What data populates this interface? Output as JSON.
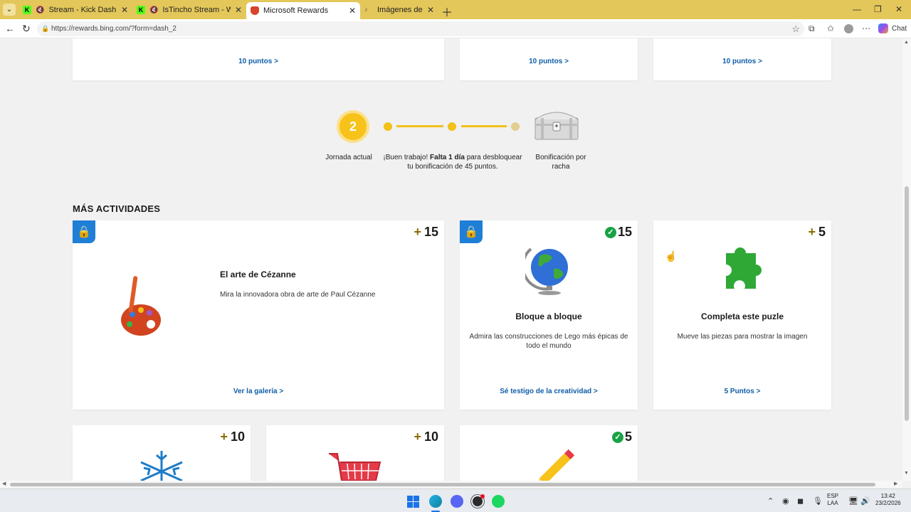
{
  "browser": {
    "tabs": [
      {
        "title": "Stream - Kick Dashboard",
        "favicon_color": "#53fc18"
      },
      {
        "title": "IsTincho Stream - Watch Live",
        "favicon_color": "#53fc18"
      },
      {
        "title": "Microsoft Rewards",
        "favicon_color": "#d8442a"
      },
      {
        "title": "Imágenes de obras",
        "favicon_color": "#555555"
      }
    ],
    "url": "https://rewards.bing.com/?form=dash_2",
    "chat_label": "Chat"
  },
  "top_cards": [
    {
      "link": "10 puntos >"
    },
    {
      "link": "10 puntos >"
    },
    {
      "link": "10 puntos >"
    }
  ],
  "streak": {
    "current_day": "2",
    "current_label": "Jornada actual",
    "message_prefix": "¡Buen trabajo! ",
    "message_bold": "Falta 1 día",
    "message_suffix": " para desbloquear tu bonificación de 45 puntos.",
    "bonus_label": "Bonificación por racha"
  },
  "section_title": "MÁS ACTIVIDADES",
  "activities": [
    {
      "points_prefix": "+",
      "points": "15",
      "title": "El arte de Cézanne",
      "description": "Mira la innovadora obra de arte de Paul Cézanne",
      "link": "Ver la galería >",
      "locked": true,
      "completed": false
    },
    {
      "points_prefix": "",
      "points": "15",
      "title": "Bloque a bloque",
      "description": "Admira las construcciones de Lego más épicas de todo el mundo",
      "link": "Sé testigo de la creatividad >",
      "locked": true,
      "completed": true
    },
    {
      "points_prefix": "+",
      "points": "5",
      "title": "Completa este puzle",
      "description": "Mueve las piezas para mostrar la imagen",
      "link": "5 Puntos >",
      "locked": false,
      "completed": false
    }
  ],
  "bottom_cards": [
    {
      "points_prefix": "+",
      "points": "10",
      "icon": "snowflake-icon",
      "completed": false
    },
    {
      "points_prefix": "+",
      "points": "10",
      "icon": "shopping-cart-icon",
      "completed": false
    },
    {
      "points_prefix": "",
      "points": "5",
      "icon": "pencil-icon",
      "completed": true
    }
  ],
  "taskbar": {
    "language_top": "ESP",
    "language_bottom": "LAA",
    "time": "13:42",
    "date": "23/2/2026"
  },
  "colors": {
    "titlebar": "#e4c75a",
    "accent_gold": "#f7c21a",
    "link_blue": "#0f5ea8",
    "lock_blue": "#1f7fd6",
    "check_green": "#17a345"
  }
}
